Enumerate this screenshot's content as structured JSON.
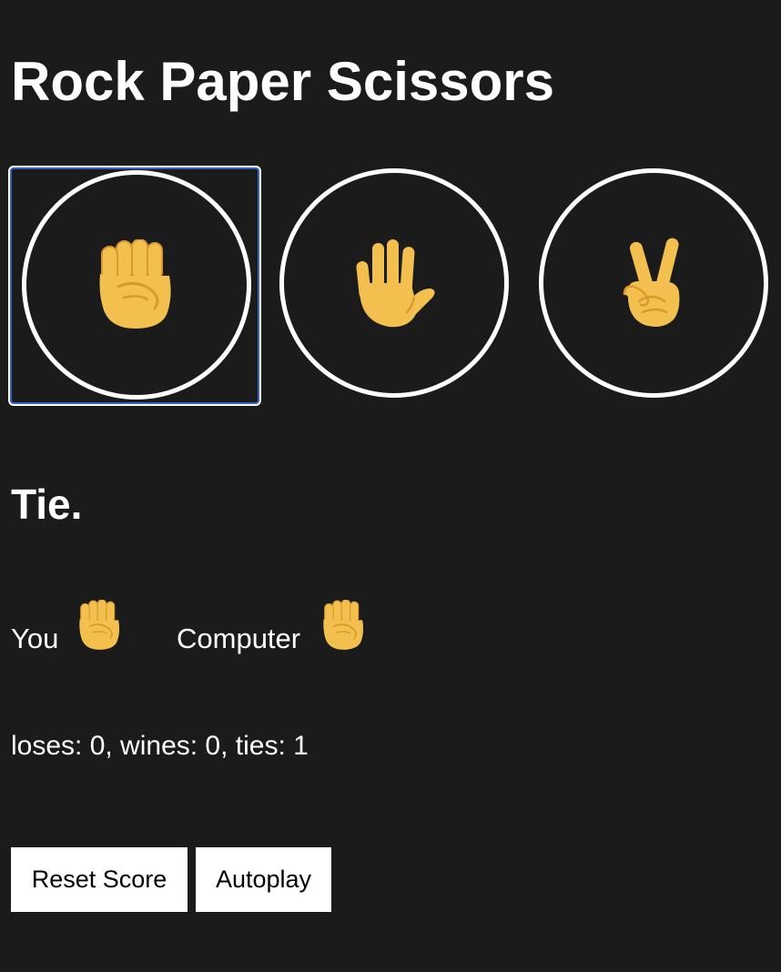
{
  "title": "Rock Paper Scissors",
  "moves": [
    {
      "name": "rock",
      "icon": "raised-fist-icon",
      "selected": true
    },
    {
      "name": "paper",
      "icon": "raised-hand-icon",
      "selected": false
    },
    {
      "name": "scissors",
      "icon": "victory-hand-icon",
      "selected": false
    }
  ],
  "result": "Tie.",
  "player": {
    "label": "You",
    "move_icon": "raised-fist-icon"
  },
  "computer": {
    "label": "Computer",
    "move_icon": "raised-fist-icon"
  },
  "score_text": "loses: 0, wines: 0, ties: 1",
  "buttons": {
    "reset": "Reset Score",
    "autoplay": "Autoplay"
  },
  "colors": {
    "background": "#1b1b1b",
    "text": "#ffffff",
    "emoji_skin": "#f3c04f",
    "emoji_shade": "#d99a2b",
    "focus_ring": "#2f64c9"
  }
}
